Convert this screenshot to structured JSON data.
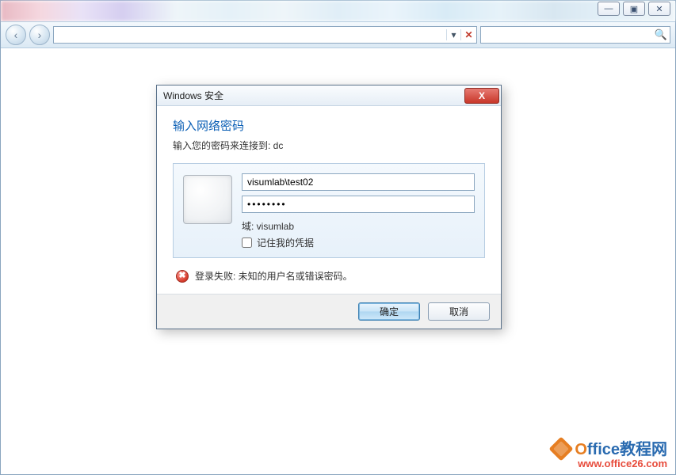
{
  "window": {
    "caption_min": "—",
    "caption_max": "▣",
    "caption_close": "✕"
  },
  "nav": {
    "address_value": "",
    "dropdown_glyph": "▾",
    "clear_glyph": "✕",
    "search_value": "",
    "search_icon": "🔍"
  },
  "dialog": {
    "title": "Windows 安全",
    "heading": "输入网络密码",
    "subtext": "输入您的密码来连接到: dc",
    "username_value": "visumlab\\test02",
    "password_value": "••••••••",
    "domain_label": "域: visumlab",
    "remember_label": "记住我的凭据",
    "remember_checked": false,
    "error_text": "登录失败: 未知的用户名或错误密码。",
    "ok_label": "确定",
    "cancel_label": "取消",
    "close_glyph": "X"
  },
  "watermark": {
    "line1_bold": "O",
    "line1_rest": "ffice教程网",
    "line2": "www.office26.com"
  }
}
